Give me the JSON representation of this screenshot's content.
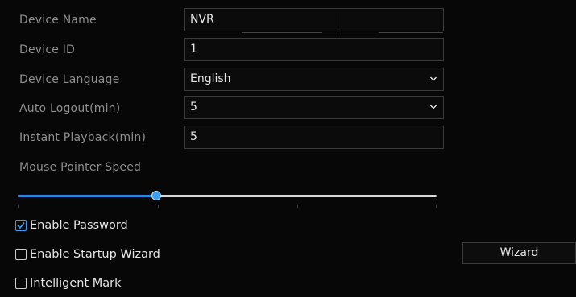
{
  "form": {
    "device_name": {
      "label": "Device Name",
      "value": "NVR"
    },
    "device_id": {
      "label": "Device ID",
      "value": "1"
    },
    "device_language": {
      "label": "Device Language",
      "value": "English"
    },
    "auto_logout": {
      "label": "Auto Logout(min)",
      "value": "5"
    },
    "instant_playback": {
      "label": "Instant Playback(min)",
      "value": "5"
    },
    "mouse_pointer_speed": {
      "label": "Mouse Pointer Speed",
      "level": 0.33
    }
  },
  "options": {
    "enable_password": {
      "label": "Enable Password",
      "checked": true
    },
    "enable_startup_wizard": {
      "label": "Enable Startup Wizard",
      "checked": false
    },
    "intelligent_mark": {
      "label": "Intelligent Mark",
      "checked": false
    }
  },
  "buttons": {
    "wizard_label": "Wizard"
  },
  "colors": {
    "accent": "#3aa0f4",
    "text": "#e6e6e6",
    "label": "#8f8f8f",
    "background": "#070707"
  }
}
